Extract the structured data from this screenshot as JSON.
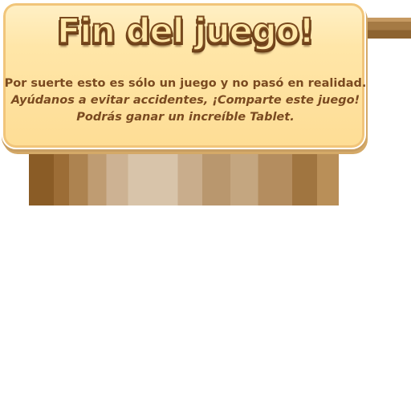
{
  "game_over_panel": {
    "title": "Fin del juego!",
    "message_line_1": "Por suerte esto es sólo un juego y no pasó en realidad.",
    "message_line_2": "Ayúdanos a evitar accidentes, ¡Comparte este juego!",
    "message_line_3": "Podrás ganar un increíble Tablet."
  },
  "colors": {
    "sign_fill": "#fedd95",
    "sign_border": "#ffffff",
    "title_fill": "#ffe8a8",
    "title_outline": "#7a4a1e",
    "message_text": "#7a4a20",
    "wood_dark": "#8a5c26",
    "wood_light": "#d8c4aa",
    "background": "#ffffff"
  }
}
